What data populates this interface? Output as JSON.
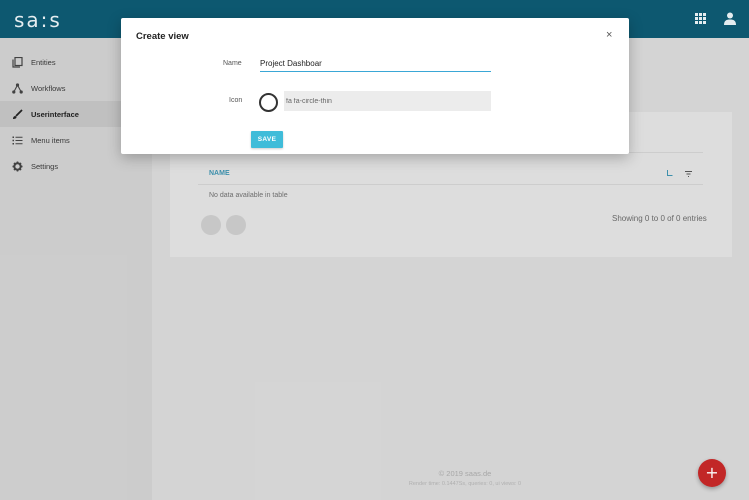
{
  "app": {
    "logo": "sa:s"
  },
  "colors": {
    "topbar": "#0e5a73",
    "accent": "#3aa7d6",
    "save": "#3fbcd9",
    "fab": "#c62828"
  },
  "topbar": {
    "icons": [
      "apps-grid-icon",
      "user-icon"
    ]
  },
  "sidebar": {
    "items": [
      {
        "label": "Entities",
        "icon": "entities-icon",
        "active": false
      },
      {
        "label": "Workflows",
        "icon": "workflow-icon",
        "active": false
      },
      {
        "label": "Userinterface",
        "icon": "brush-icon",
        "active": true
      },
      {
        "label": "Menu items",
        "icon": "list-icon",
        "active": false
      },
      {
        "label": "Settings",
        "icon": "gear-icon",
        "active": false
      }
    ]
  },
  "table": {
    "columns": [
      "NAME"
    ],
    "empty_message": "No data available in table",
    "entries_info": "Showing 0 to 0 of 0 entries"
  },
  "footer": {
    "copyright": "© 2019 saas.de",
    "debug": "Render time: 0.1447Ss, queries: 0, ui views: 0"
  },
  "fab": {
    "label": "+"
  },
  "modal": {
    "title": "Create view",
    "close_label": "×",
    "name_label": "Name",
    "name_value": "Project Dashboar",
    "icon_label": "Icon",
    "icon_value": "fa fa-circle-thin",
    "save_label": "SAVE"
  }
}
